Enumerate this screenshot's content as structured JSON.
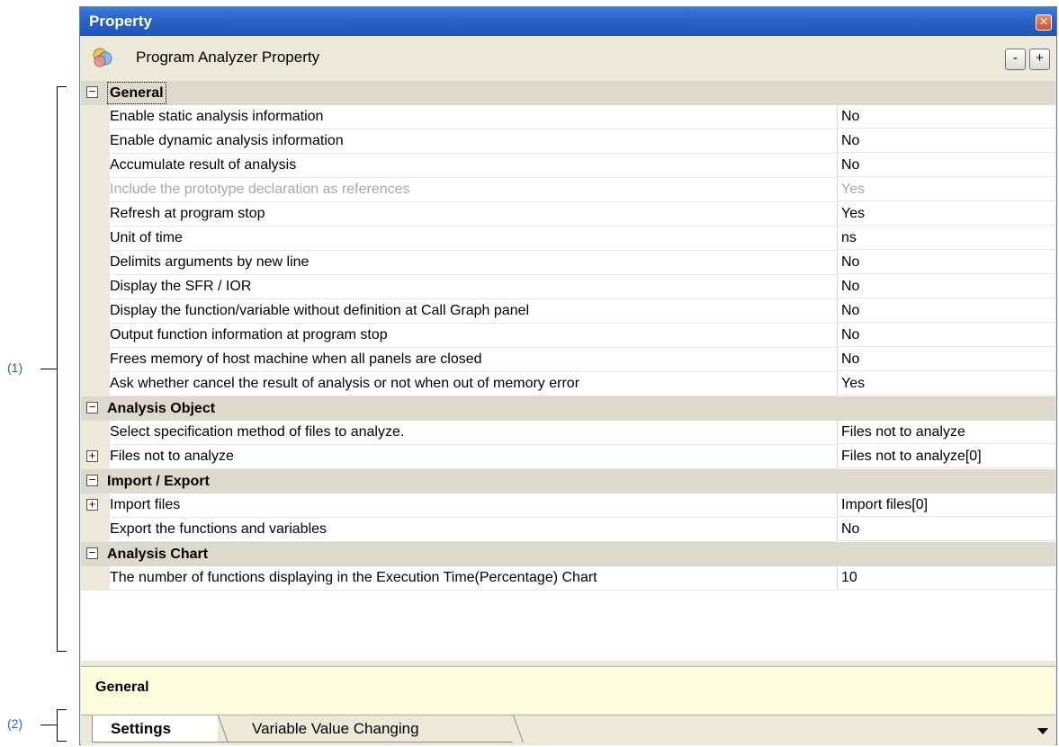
{
  "callouts": {
    "one": "(1)",
    "two": "(2)"
  },
  "window": {
    "title": "Property"
  },
  "header": {
    "title": "Program Analyzer Property",
    "collapse_label": "-",
    "expand_label": "+"
  },
  "categories": {
    "general": "General",
    "analysis_object": "Analysis Object",
    "import_export": "Import / Export",
    "analysis_chart": "Analysis Chart"
  },
  "general": [
    {
      "name": "Enable static analysis information",
      "value": "No"
    },
    {
      "name": "Enable dynamic analysis information",
      "value": "No"
    },
    {
      "name": "Accumulate result of analysis",
      "value": "No"
    },
    {
      "name": "Include the prototype declaration as references",
      "value": "Yes"
    },
    {
      "name": "Refresh at program stop",
      "value": "Yes"
    },
    {
      "name": "Unit of time",
      "value": "ns"
    },
    {
      "name": "Delimits arguments by new line",
      "value": "No"
    },
    {
      "name": "Display the SFR / IOR",
      "value": "No"
    },
    {
      "name": "Display the function/variable without definition at Call Graph panel",
      "value": "No"
    },
    {
      "name": "Output function information at program stop",
      "value": "No"
    },
    {
      "name": "Frees memory of host machine when all panels are closed",
      "value": "No"
    },
    {
      "name": "Ask whether cancel the result of analysis or not when out of memory error",
      "value": "Yes"
    }
  ],
  "analysis_object": [
    {
      "name": "Select specification method of files to analyze.",
      "value": "Files not to analyze"
    },
    {
      "name": "Files not to analyze",
      "value": "Files not to analyze[0]"
    }
  ],
  "import_export": [
    {
      "name": "Import files",
      "value": "Import files[0]"
    },
    {
      "name": "Export the functions and variables",
      "value": "No"
    }
  ],
  "analysis_chart": [
    {
      "name": "The number of functions displaying in the Execution Time(Percentage) Chart",
      "value": "10"
    }
  ],
  "description": {
    "title": "General"
  },
  "tabs": {
    "settings": "Settings",
    "variable": "Variable Value Changing"
  }
}
